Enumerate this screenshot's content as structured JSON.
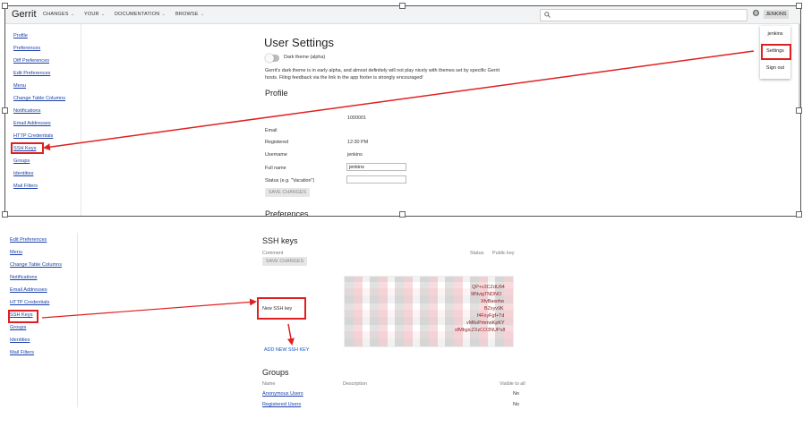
{
  "top": {
    "app_name": "Gerrit",
    "nav": [
      {
        "label": "CHANGES"
      },
      {
        "label": "YOUR"
      },
      {
        "label": "DOCUMENTATION"
      },
      {
        "label": "BROWSE"
      }
    ],
    "user_button": "JENKINS",
    "dropdown": {
      "user": "jenkins",
      "settings": "Settings",
      "sign_out": "Sign out"
    },
    "sidebar": [
      "Profile",
      "Preferences",
      "Diff Preferences",
      "Edit Preferences",
      "Menu",
      "Change Table Columns",
      "Notifications",
      "Email Addresses",
      "HTTP Credentials",
      "SSH Keys",
      "Groups",
      "Identities",
      "Mail Filters"
    ],
    "title": "User Settings",
    "dark_theme_label": "Dark theme (alpha)",
    "dark_theme_note_1": "Gerrit's dark theme is in early alpha, and almost definitely will not play nicely with themes set by specific Gerrit",
    "dark_theme_note_2": "hosts. Filing feedback via the link in the app footer is strongly encouraged!",
    "profile_heading": "Profile",
    "profile": {
      "id_value": "1000001",
      "email_label": "Email",
      "registered_label": "Registered",
      "registered_value": "12:30 PM",
      "username_label": "Username",
      "username_value": "jenkins",
      "fullname_label": "Full name",
      "fullname_value": "jenkins",
      "status_label": "Status (e.g. \"Vacation\")",
      "status_value": ""
    },
    "save_changes": "SAVE CHANGES",
    "preferences_heading": "Preferences"
  },
  "bottom": {
    "sidebar": [
      "Edit Preferences",
      "Menu",
      "Change Table Columns",
      "Notifications",
      "Email Addresses",
      "HTTP Credentials",
      "SSH Keys",
      "Groups",
      "Identities",
      "Mail Filters"
    ],
    "ssh_heading": "SSH keys",
    "comment_col": "Comment",
    "status_col": "Status",
    "public_key_col": "Public key",
    "save_changes": "SAVE CHANGES",
    "key_fragments": [
      "QP+v3CZdU94",
      "9lNvigTNDNO",
      "XfvBaxnhe",
      "BZxyv9K",
      "f4FxyFgf+Td",
      "vM6oPmmoKpKY",
      "sfMbgicZXzCO3NUPs8"
    ],
    "new_ssh_key": "New SSH key",
    "add_new_ssh_key": "ADD NEW SSH KEY",
    "groups_heading": "Groups",
    "groups_cols": {
      "name": "Name",
      "description": "Description",
      "visible": "Visible to all"
    },
    "groups": [
      {
        "name": "Anonymous Users",
        "visible": "No"
      },
      {
        "name": "Registered Users",
        "visible": "No"
      }
    ]
  },
  "colors": {
    "annotation": "#e02020",
    "link": "#1a3fa8",
    "accent_button": "#e6e6e6"
  }
}
